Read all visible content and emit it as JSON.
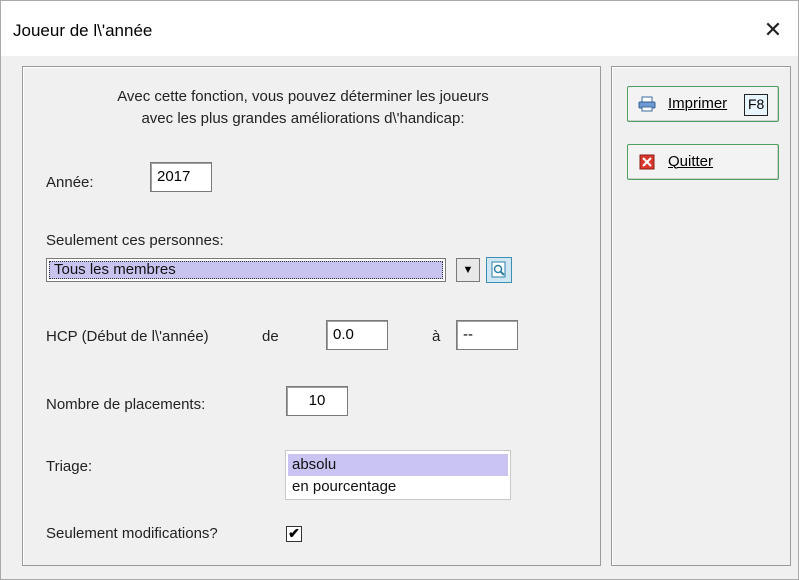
{
  "window": {
    "title": "Joueur de l\\'année",
    "close_symbol": "✕"
  },
  "description": {
    "line1": "Avec cette fonction, vous pouvez déterminer les joueurs",
    "line2": "avec les plus grandes améliorations d\\'handicap:"
  },
  "year": {
    "label": "Année:",
    "value": "2017"
  },
  "persons": {
    "label": "Seulement ces personnes:",
    "value": "Tous les membres",
    "arrow": "▼"
  },
  "hcp": {
    "label": "HCP (Début de l\\'année)",
    "from_label": "de",
    "from_value": "0.0",
    "to_label": "à",
    "to_value": "--"
  },
  "placements": {
    "label": "Nombre de placements:",
    "value": "10"
  },
  "sorting": {
    "label": "Triage:",
    "options": [
      "absolu",
      "en pourcentage"
    ],
    "selected": "absolu"
  },
  "only_changes": {
    "label": "Seulement modifications?",
    "checked": true,
    "check_symbol": "✔"
  },
  "buttons": {
    "print": {
      "label": "Imprimer",
      "shortcut": "F8"
    },
    "quit": {
      "label": "Quitter"
    }
  },
  "colors": {
    "selection": "#c9c4f2",
    "button_border": "#4f9f5f",
    "quit_icon": "#d9372b"
  }
}
